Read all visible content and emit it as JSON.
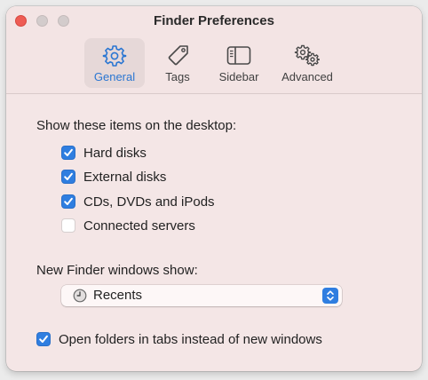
{
  "window": {
    "title": "Finder Preferences"
  },
  "toolbar": {
    "tabs": [
      {
        "label": "General",
        "icon": "gear-icon",
        "selected": true
      },
      {
        "label": "Tags",
        "icon": "tag-icon",
        "selected": false
      },
      {
        "label": "Sidebar",
        "icon": "sidebar-icon",
        "selected": false
      },
      {
        "label": "Advanced",
        "icon": "gears-icon",
        "selected": false
      }
    ]
  },
  "general": {
    "desktop_section_label": "Show these items on the desktop:",
    "desktop_items": [
      {
        "label": "Hard disks",
        "checked": true
      },
      {
        "label": "External disks",
        "checked": true
      },
      {
        "label": "CDs, DVDs and iPods",
        "checked": true
      },
      {
        "label": "Connected servers",
        "checked": false
      }
    ],
    "new_window_label": "New Finder windows show:",
    "new_window_popup": {
      "value": "Recents",
      "icon": "clock-icon"
    },
    "open_in_tabs": {
      "label": "Open folders in tabs instead of new windows",
      "checked": true
    }
  },
  "colors": {
    "accent": "#2f7ee0",
    "window_background": "#f4e6e6",
    "close_button": "#ee5c54"
  }
}
